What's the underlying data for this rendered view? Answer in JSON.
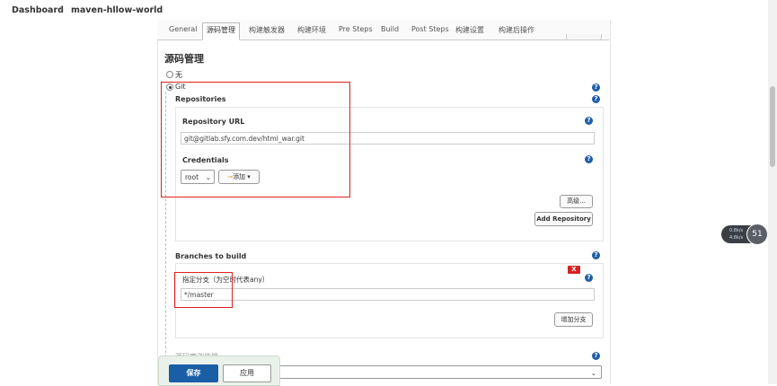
{
  "breadcrumb": {
    "dashboard": "Dashboard",
    "project": "maven-hllow-world",
    "sep": "›"
  },
  "tabs": [
    "General",
    "源码管理",
    "构建触发器",
    "构建环境",
    "Pre Steps",
    "Build",
    "Post Steps",
    "构建设置",
    "构建后操作"
  ],
  "section_title": "源码管理",
  "scm": {
    "option_none": "无",
    "option_git": "Git",
    "repositories_label": "Repositories",
    "repo_url_label": "Repository URL",
    "repo_url_value": "git@gitlab.sfy.com.dev/html_war.git",
    "credentials_label": "Credentials",
    "credentials_value": "root",
    "add_label": "添加",
    "advanced_label": "高级...",
    "add_repository_label": "Add Repository"
  },
  "branches": {
    "title": "Branches to build",
    "branch_label": "指定分支（为空时代表any）",
    "branch_value": "*/master",
    "add_branch_label": "增加分支",
    "delete_label": "X"
  },
  "next_section": "源码库浏览器",
  "actions": {
    "save": "保存",
    "apply": "应用"
  },
  "widget": {
    "line1": "0.8k/s",
    "line2": "4.8k/s",
    "percent": "51"
  },
  "help_symbol": "?"
}
